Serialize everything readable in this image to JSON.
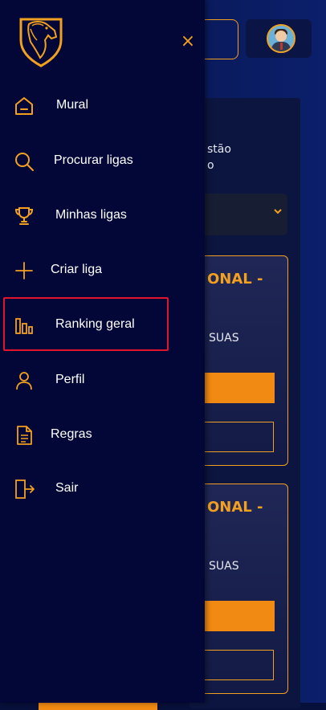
{
  "drawer": {
    "close_symbol": "×",
    "items": [
      {
        "label": "Mural",
        "icon": "home-icon"
      },
      {
        "label": "Procurar ligas",
        "icon": "search-icon"
      },
      {
        "label": "Minhas ligas",
        "icon": "trophy-icon"
      },
      {
        "label": "Criar liga",
        "icon": "plus-icon"
      },
      {
        "label": "Ranking geral",
        "icon": "bar-chart-icon",
        "highlighted": true
      },
      {
        "label": "Perfil",
        "icon": "user-icon"
      },
      {
        "label": "Regras",
        "icon": "document-icon"
      },
      {
        "label": "Sair",
        "icon": "logout-icon"
      }
    ]
  },
  "background": {
    "text_line1": "stão",
    "text_line2": "o",
    "cards": [
      {
        "title": "ONAL -",
        "text": "SUAS"
      },
      {
        "title": "ONAL -",
        "text": "SUAS"
      }
    ]
  },
  "colors": {
    "accent": "#f2a020",
    "drawer_bg": "#030737",
    "highlight": "#e0142a"
  }
}
